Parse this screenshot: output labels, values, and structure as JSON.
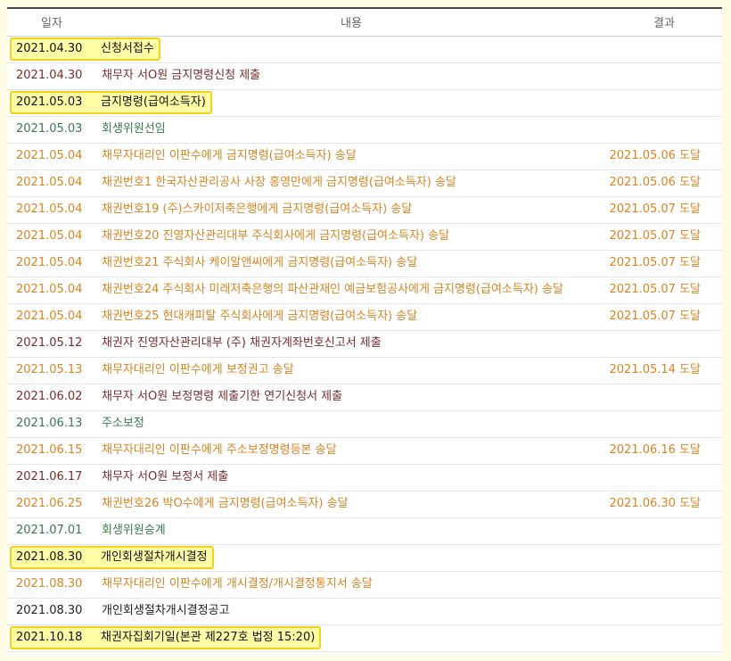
{
  "headers": {
    "date": "일자",
    "content": "내용",
    "result": "결과"
  },
  "colors": {
    "black": "#222222",
    "orange": "#d88422",
    "maroon": "#7b2c2c",
    "green": "#3b7a4b",
    "highlight_fill": "#fffca6",
    "highlight_border": "#f2d21c"
  },
  "rows": [
    {
      "date": "2021.04.30",
      "content": "신청서접수",
      "result": "",
      "style": "highlight"
    },
    {
      "date": "2021.04.30",
      "content": "채무자 서O원 금지명령신청 제출",
      "result": "",
      "style": "maroon"
    },
    {
      "date": "2021.05.03",
      "content": "금지명령(급여소득자)",
      "result": "",
      "style": "highlight"
    },
    {
      "date": "2021.05.03",
      "content": "회생위원선임",
      "result": "",
      "style": "green"
    },
    {
      "date": "2021.05.04",
      "content": "채무자대리인 이판수에게 금지명령(급여소득자) 송달",
      "result": "2021.05.06 도달",
      "style": "orange"
    },
    {
      "date": "2021.05.04",
      "content": "채권번호1 한국자산관리공사 사장 홍영만에게 금지명령(급여소득자) 송달",
      "result": "2021.05.06 도달",
      "style": "orange"
    },
    {
      "date": "2021.05.04",
      "content": "채권번호19 (주)스카이저축은행에게 금지명령(급여소득자) 송달",
      "result": "2021.05.07 도달",
      "style": "orange"
    },
    {
      "date": "2021.05.04",
      "content": "채권번호20 진영자산관리대부 주식회사에게 금지명령(급여소득자) 송달",
      "result": "2021.05.07 도달",
      "style": "orange"
    },
    {
      "date": "2021.05.04",
      "content": "채권번호21 주식회사 케이알앤씨에게 금지명령(급여소득자) 송달",
      "result": "2021.05.07 도달",
      "style": "orange"
    },
    {
      "date": "2021.05.04",
      "content": "채권번호24 주식회사 미래저축은행의 파산관재인 예금보험공사에게 금지명령(급여소득자) 송달",
      "result": "2021.05.07 도달",
      "style": "orange"
    },
    {
      "date": "2021.05.04",
      "content": "채권번호25 현대캐피탈 주식회사에게 금지명령(급여소득자) 송달",
      "result": "2021.05.07 도달",
      "style": "orange"
    },
    {
      "date": "2021.05.12",
      "content": "채권자 진영자산관리대부 (주) 채권자계좌번호신고서 제출",
      "result": "",
      "style": "maroon"
    },
    {
      "date": "2021.05.13",
      "content": "채무자대리인 이판수에게 보정권고 송달",
      "result": "2021.05.14 도달",
      "style": "orange"
    },
    {
      "date": "2021.06.02",
      "content": "채무자 서O원 보정명령 제출기한 연기신청서 제출",
      "result": "",
      "style": "maroon"
    },
    {
      "date": "2021.06.13",
      "content": "주소보정",
      "result": "",
      "style": "green"
    },
    {
      "date": "2021.06.15",
      "content": "채무자대리인 이판수에게 주소보정명령등본 송달",
      "result": "2021.06.16 도달",
      "style": "orange"
    },
    {
      "date": "2021.06.17",
      "content": "채무자 서O원 보정서 제출",
      "result": "",
      "style": "maroon"
    },
    {
      "date": "2021.06.25",
      "content": "채권번호26 박O수에게 금지명령(급여소득자) 송달",
      "result": "2021.06.30 도달",
      "style": "orange"
    },
    {
      "date": "2021.07.01",
      "content": "회생위원승계",
      "result": "",
      "style": "green"
    },
    {
      "date": "2021.08.30",
      "content": "개인회생절차개시결정",
      "result": "",
      "style": "highlight"
    },
    {
      "date": "2021.08.30",
      "content": "채무자대리인 이판수에게 개시결정/개시결정통지서 송달",
      "result": "",
      "style": "orange"
    },
    {
      "date": "2021.08.30",
      "content": "개인회생절차개시결정공고",
      "result": "",
      "style": "black"
    },
    {
      "date": "2021.10.18",
      "content": "채권자집회기일(본관 제227호 법정 15:20)",
      "result": "",
      "style": "highlight"
    }
  ]
}
